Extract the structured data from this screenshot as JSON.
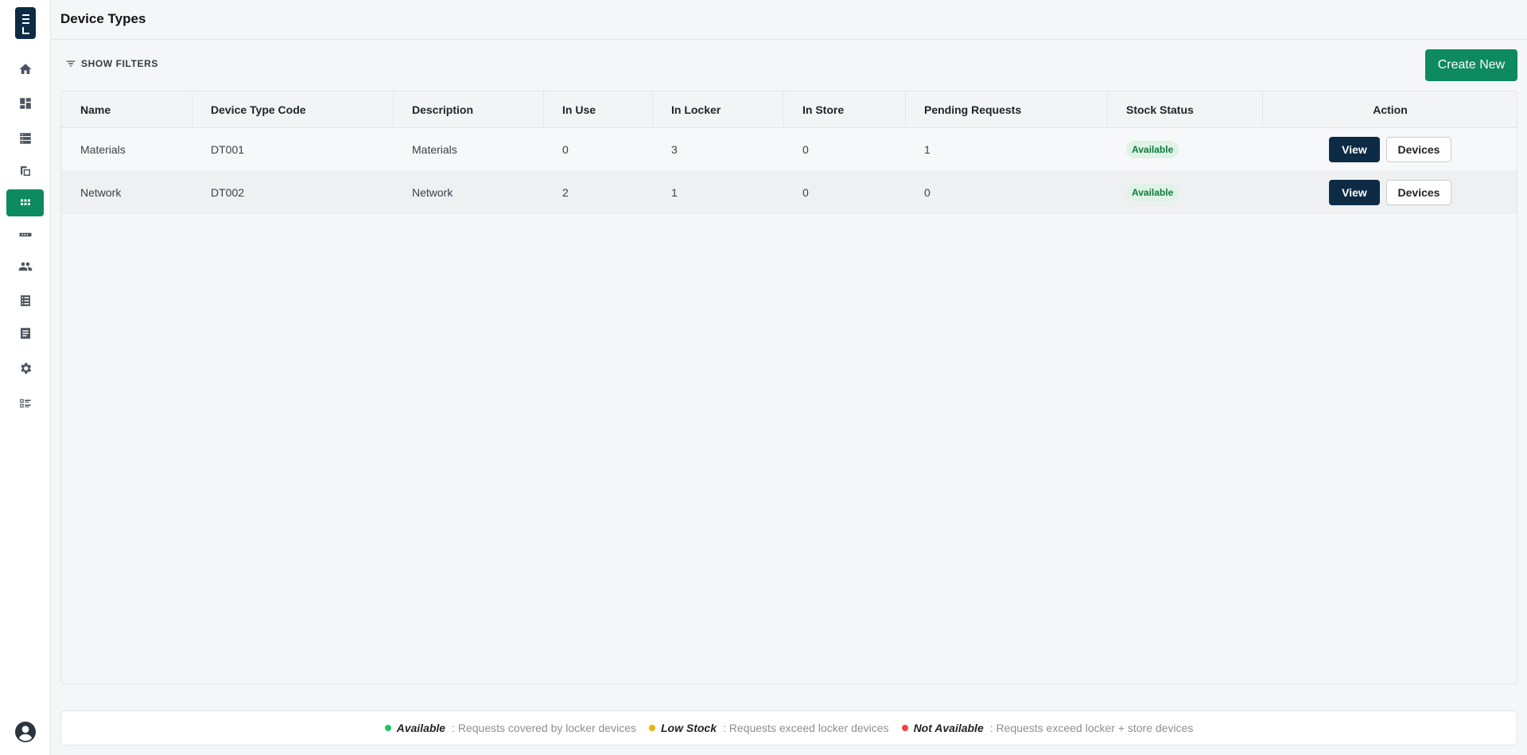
{
  "header": {
    "title": "Device Types"
  },
  "sidebar": {
    "items": [
      {
        "icon": "home-icon",
        "active": false
      },
      {
        "icon": "dashboard-icon",
        "active": false
      },
      {
        "icon": "storage-icon",
        "active": false
      },
      {
        "icon": "devices-icon",
        "active": false
      },
      {
        "icon": "grid-apps-icon",
        "active": true
      },
      {
        "icon": "hardware-icon",
        "active": false
      },
      {
        "icon": "users-icon",
        "active": false
      },
      {
        "icon": "list-icon",
        "active": false
      },
      {
        "icon": "document-icon",
        "active": false
      },
      {
        "icon": "gear-icon",
        "active": false
      },
      {
        "icon": "checklist-icon",
        "active": false
      }
    ]
  },
  "toolbar": {
    "show_filters_label": "SHOW FILTERS",
    "create_label": "Create New"
  },
  "table": {
    "columns": [
      "Name",
      "Device Type Code",
      "Description",
      "In Use",
      "In Locker",
      "In Store",
      "Pending Requests",
      "Stock Status",
      "Action"
    ],
    "rows": [
      {
        "name": "Materials",
        "code": "DT001",
        "description": "Materials",
        "in_use": "0",
        "in_locker": "3",
        "in_store": "0",
        "pending": "1",
        "status": "Available",
        "view_label": "View",
        "devices_label": "Devices"
      },
      {
        "name": "Network",
        "code": "DT002",
        "description": "Network",
        "in_use": "2",
        "in_locker": "1",
        "in_store": "0",
        "pending": "0",
        "status": "Available",
        "view_label": "View",
        "devices_label": "Devices"
      }
    ]
  },
  "legend": {
    "items": [
      {
        "name": "Available",
        "desc": ": Requests covered by locker devices",
        "color": "#22c55e"
      },
      {
        "name": "Low Stock",
        "desc": ": Requests exceed locker devices",
        "color": "#eab308"
      },
      {
        "name": "Not Available",
        "desc": ": Requests exceed locker + store devices",
        "color": "#ef4444"
      }
    ]
  },
  "colors": {
    "accent": "#0d8a5f",
    "navy": "#0d2b45"
  }
}
